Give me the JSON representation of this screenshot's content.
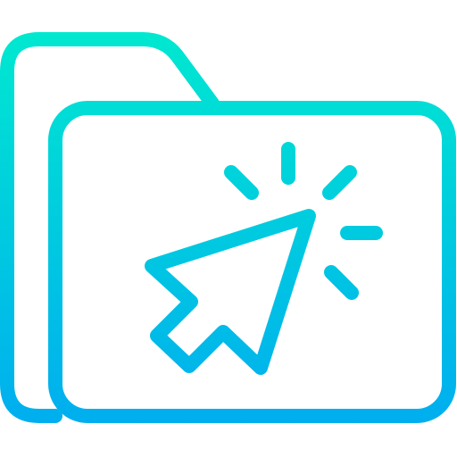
{
  "icon": {
    "name": "folder-click-icon",
    "colors": {
      "gradient_top": "#00E8D0",
      "gradient_bottom": "#00AEEF",
      "background": "#FFFFFF"
    }
  }
}
